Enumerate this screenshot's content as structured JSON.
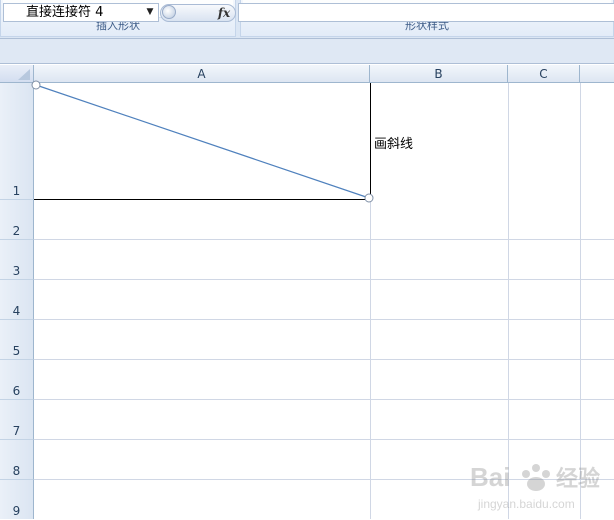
{
  "ribbon": {
    "groups": [
      {
        "label": "插入形状"
      },
      {
        "label": "形状样式"
      }
    ]
  },
  "formula_bar": {
    "name_box": "直接连接符 4",
    "fx_label": "fx",
    "formula": ""
  },
  "columns": [
    "A",
    "B",
    "C"
  ],
  "rows": [
    "1",
    "2",
    "3",
    "4",
    "5",
    "6",
    "7",
    "8",
    "9"
  ],
  "cells": {
    "B1": "画斜线"
  },
  "shapes": {
    "connector_name": "直接连接符 4"
  },
  "watermark": {
    "brand": "Bai",
    "brand_suffix": "经验",
    "url": "jingyan.baidu.com"
  },
  "colors": {
    "line": "#4f81bd",
    "handle": "#ffffff"
  }
}
